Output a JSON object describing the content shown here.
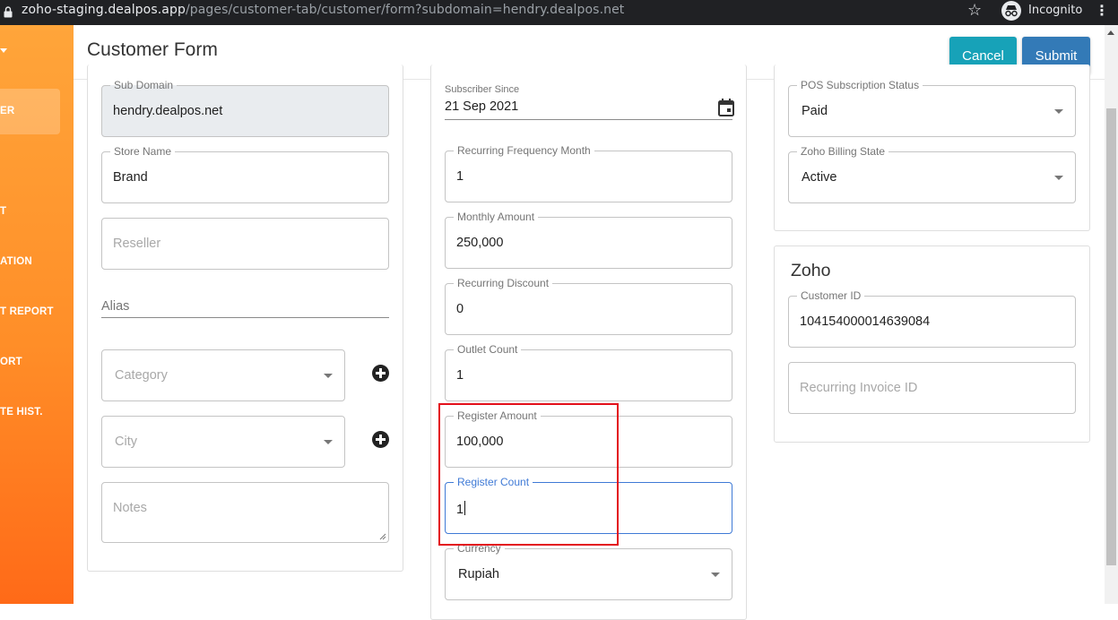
{
  "browser": {
    "url_host": "zoho-staging.dealpos.app",
    "url_path": "/pages/customer-tab/customer/form?subdomain=hendry.dealpos.net",
    "profile_label": "Incognito"
  },
  "sidebar": {
    "items": [
      {
        "label": "ER",
        "active": true
      },
      {
        "label": "T"
      },
      {
        "label": "ATION"
      },
      {
        "label": "T REPORT"
      },
      {
        "label": "ORT"
      },
      {
        "label": "TE HIST."
      }
    ]
  },
  "header": {
    "title": "Customer Form",
    "cancel_label": "Cancel",
    "submit_label": "Submit"
  },
  "left_column": {
    "sub_domain": {
      "label": "Sub Domain",
      "value": "hendry.dealpos.net"
    },
    "store_name": {
      "label": "Store Name",
      "value": "Brand"
    },
    "reseller": {
      "placeholder": "Reseller"
    },
    "alias": {
      "placeholder": "Alias"
    },
    "category": {
      "placeholder": "Category"
    },
    "city": {
      "placeholder": "City"
    },
    "notes": {
      "placeholder": "Notes"
    }
  },
  "middle_column": {
    "subscriber_since": {
      "label": "Subscriber Since",
      "value": "21 Sep 2021"
    },
    "recurring_frequency_month": {
      "label": "Recurring Frequency Month",
      "value": "1"
    },
    "monthly_amount": {
      "label": "Monthly Amount",
      "value": "250,000"
    },
    "recurring_discount": {
      "label": "Recurring Discount",
      "value": "0"
    },
    "outlet_count": {
      "label": "Outlet Count",
      "value": "1"
    },
    "register_amount": {
      "label": "Register Amount",
      "value": "100,000"
    },
    "register_count": {
      "label": "Register Count",
      "value": "1"
    },
    "currency": {
      "label": "Currency",
      "value": "Rupiah"
    }
  },
  "right_column": {
    "pos_subscription_status": {
      "label": "POS Subscription Status",
      "value": "Paid"
    },
    "zoho_billing_state": {
      "label": "Zoho Billing State",
      "value": "Active"
    },
    "zoho": {
      "title": "Zoho",
      "customer_id": {
        "label": "Customer ID",
        "value": "104154000014639084"
      },
      "recurring_invoice_id": {
        "placeholder": "Recurring Invoice ID"
      }
    }
  },
  "colors": {
    "sidebar_gradient_top": "#ffa53a",
    "sidebar_gradient_bottom": "#ff6a18",
    "cancel_button": "#17a2b8",
    "submit_button": "#337ab7",
    "focus_blue": "#3f7ad6",
    "highlight_red": "#e3101b"
  }
}
